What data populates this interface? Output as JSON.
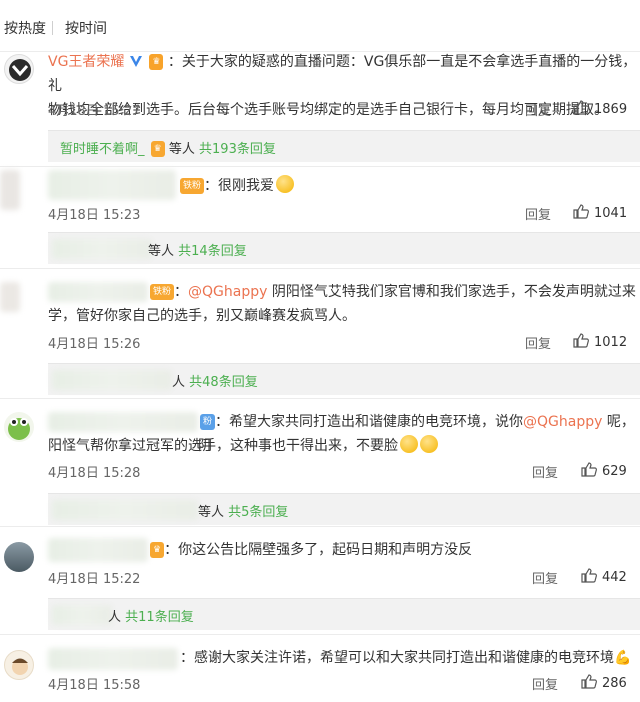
{
  "sort_tabs": [
    "按热度",
    "按时间"
  ],
  "comments": [
    {
      "user": "VG王者荣耀",
      "text_prefix": "：",
      "text": "关于大家的疑惑的直播问题：VG俱乐部一直是不会拿选手直播的一分钱，礼物钱均全部给到选手。后台每个选手账号均绑定的是选手自己银行卡，每月均可定期提取。",
      "line1": "：关于大家的疑惑的直播问题：VG俱乐部一直是不会拿选手直播的一分钱，礼",
      "line2": "物钱均全部给到选手。后台每个选手账号均绑定的是选手自己银行卡，每月均可定期提取。",
      "time": "4月18日 15:27",
      "reply": "回复",
      "likes": "1869",
      "sub_user": "暂时睡不着啊_",
      "sub_mid": "等人",
      "sub_count": "共193条回复"
    },
    {
      "badge": "铁粉",
      "line1": "：很刚我爱",
      "time": "4月18日 15:23",
      "reply": "回复",
      "likes": "1041",
      "sub_mid": "等人",
      "sub_count": "共14条回复"
    },
    {
      "badge": "铁粉",
      "mention": "@QGhappy",
      "line1_rest": " 阴阳怪气艾特我们家官博和我们家选手，不会发声明就过来",
      "line2": "学，管好你家自己的选手，别又巅峰赛发疯骂人。",
      "time": "4月18日 15:26",
      "reply": "回复",
      "likes": "1012",
      "sub_mid": "人",
      "sub_count": "共48条回复"
    },
    {
      "badge": "粉",
      "line1_a": "：希望大家共同打造出和谐健康的电竞环境，说你",
      "mention": "@QGhappy",
      "line1_b": " 呢，阴",
      "line2": "阳怪气帮你拿过冠军的选手，这种事也干得出来，不要脸",
      "time": "4月18日 15:28",
      "reply": "回复",
      "likes": "629",
      "sub_mid": "等人",
      "sub_count": "共5条回复"
    },
    {
      "line1": "：你这公告比隔壁强多了，起码日期和声明方没反",
      "time": "4月18日 15:22",
      "reply": "回复",
      "likes": "442",
      "sub_mid": "人",
      "sub_count": "共11条回复"
    },
    {
      "line1": "：感谢大家关注许诺，希望可以和大家共同打造出和谐健康的电竞环境",
      "time": "4月18日 15:58",
      "reply": "回复",
      "likes": "286"
    }
  ]
}
